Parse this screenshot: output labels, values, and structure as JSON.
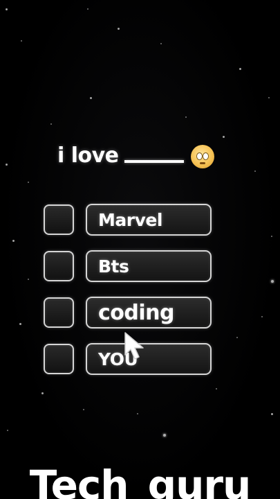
{
  "prompt": {
    "text": "i love",
    "emoji_icon": "face-with-pleading-eyes-icon"
  },
  "options": [
    {
      "label": "Marvel",
      "checked": false
    },
    {
      "label": "Bts",
      "checked": false
    },
    {
      "label": "coding",
      "checked": false
    },
    {
      "label": "YOU",
      "checked": false
    }
  ],
  "cursor_icon": "mouse-pointer-icon",
  "watermark": "Tech_guru",
  "colors": {
    "background": "#000000",
    "text": "#ffffff",
    "border": "#d6d6d6"
  }
}
